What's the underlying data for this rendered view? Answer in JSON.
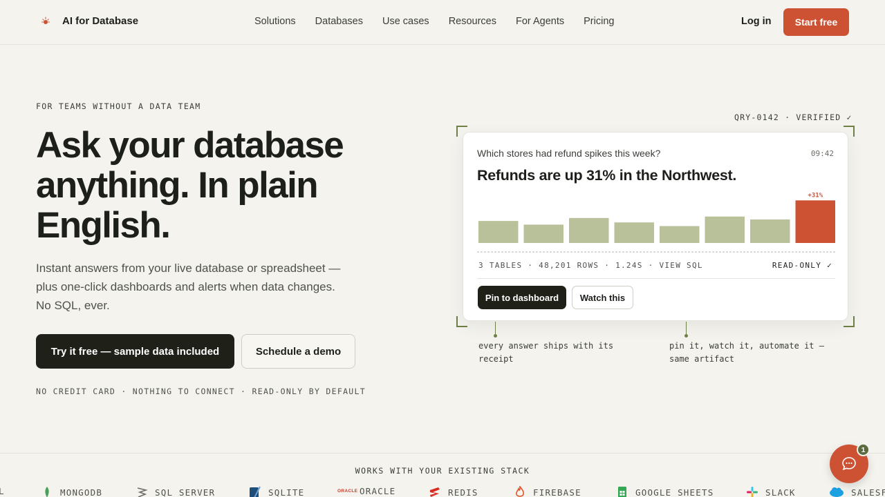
{
  "header": {
    "brand": "AI for Database",
    "nav": [
      "Solutions",
      "Databases",
      "Use cases",
      "Resources",
      "For Agents",
      "Pricing"
    ],
    "login": "Log in",
    "cta": "Start free"
  },
  "hero": {
    "eyebrow": "FOR TEAMS WITHOUT A DATA TEAM",
    "headline": [
      "Ask your database",
      "anything. In plain",
      "English."
    ],
    "subcopy": "Instant answers from your live database or spreadsheet — plus one-click dashboards and alerts when data changes. No SQL, ever.",
    "primary_cta": "Try it free — sample data included",
    "secondary_cta": "Schedule a demo",
    "fineprint": "NO CREDIT CARD · NOTHING TO CONNECT · READ-ONLY BY DEFAULT"
  },
  "card": {
    "id": "QRY-0142 · VERIFIED ✓",
    "question": "Which stores had refund spikes this week?",
    "time": "09:42",
    "answer": "Refunds are up 31% in the Northwest.",
    "meta": "3 TABLES · 48,201 ROWS · 1.24S · VIEW SQL",
    "readonly": "READ-ONLY ✓",
    "pin": "Pin to dashboard",
    "watch": "Watch this"
  },
  "chart_data": {
    "type": "bar",
    "values": [
      30,
      25,
      34,
      28,
      23,
      36,
      32,
      58
    ],
    "highlight_index": 7,
    "highlight_label": "+31%",
    "ylim": [
      0,
      62
    ],
    "colors": {
      "normal": "#b9c19a",
      "highlight": "#cd5234"
    }
  },
  "annotations": {
    "left": [
      "every answer ships with its",
      "receipt"
    ],
    "right": [
      "pin it, watch it, automate it —",
      "same artifact"
    ]
  },
  "stack": {
    "title": "WORKS WITH YOUR EXISTING STACK",
    "items": [
      {
        "label": "L"
      },
      {
        "label": "MONGODB",
        "icon": "mongodb-icon"
      },
      {
        "label": "SQL SERVER",
        "icon": "sql-server-icon"
      },
      {
        "label": "SQLITE",
        "icon": "sqlite-icon"
      },
      {
        "label": "ORACLE",
        "icon": "oracle-icon",
        "icon_text": "ORACLE"
      },
      {
        "label": "REDIS",
        "icon": "redis-icon"
      },
      {
        "label": "FIREBASE",
        "icon": "firebase-icon"
      },
      {
        "label": "GOOGLE SHEETS",
        "icon": "google-sheets-icon"
      },
      {
        "label": "SLACK",
        "icon": "slack-icon"
      },
      {
        "label": "SALESF",
        "icon": "salesforce-icon"
      }
    ]
  },
  "chat": {
    "badge": "1"
  }
}
